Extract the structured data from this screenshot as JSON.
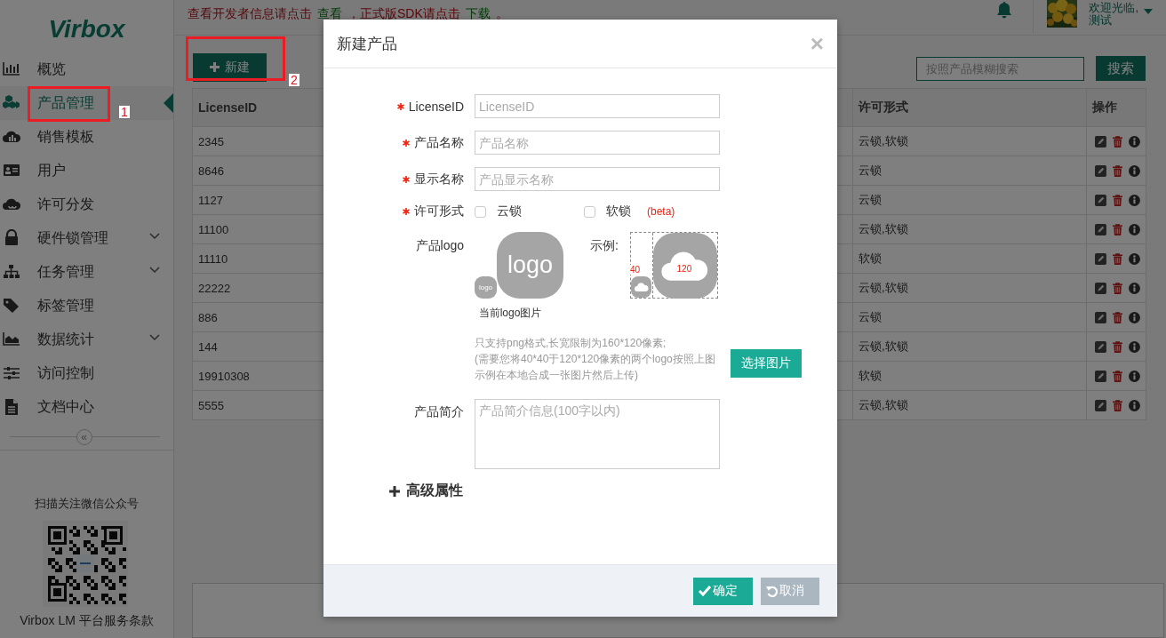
{
  "header": {
    "notice": [
      {
        "kind": "text",
        "text": "查看开发者信息请点击"
      },
      {
        "kind": "link",
        "text": "查看"
      },
      {
        "kind": "text",
        "text": "，正式版SDK请点击"
      },
      {
        "kind": "link",
        "text": "下载"
      },
      {
        "kind": "text",
        "text": "。"
      }
    ],
    "user": {
      "greeting": "欢迎光临,",
      "name": "测试"
    }
  },
  "sidebar": {
    "logo": "Virbox",
    "items": [
      {
        "label": "概览",
        "selected": false,
        "expandable": false
      },
      {
        "label": "产品管理",
        "selected": true,
        "expandable": false
      },
      {
        "label": "销售模板",
        "selected": false,
        "expandable": false
      },
      {
        "label": "用户",
        "selected": false,
        "expandable": false
      },
      {
        "label": "许可分发",
        "selected": false,
        "expandable": false
      },
      {
        "label": "硬件锁管理",
        "selected": false,
        "expandable": true
      },
      {
        "label": "任务管理",
        "selected": false,
        "expandable": true
      },
      {
        "label": "标签管理",
        "selected": false,
        "expandable": false
      },
      {
        "label": "数据统计",
        "selected": false,
        "expandable": true
      },
      {
        "label": "访问控制",
        "selected": false,
        "expandable": false
      },
      {
        "label": "文档中心",
        "selected": false,
        "expandable": false
      }
    ],
    "collapse": "«",
    "wechat_caption": "扫描关注微信公众号",
    "terms_link": "Virbox LM 平台服务条款"
  },
  "toolbar": {
    "new_button": "新建",
    "search_placeholder": "按照产品模糊搜索",
    "search_button": "搜索"
  },
  "table": {
    "columns": [
      "LicenseID",
      "许可形式",
      "操作"
    ],
    "rows": [
      {
        "license_id": "2345",
        "license_form": "云锁,软锁"
      },
      {
        "license_id": "8646",
        "license_form": "云锁"
      },
      {
        "license_id": "1127",
        "license_form": "云锁"
      },
      {
        "license_id": "11100",
        "license_form": "云锁,软锁"
      },
      {
        "license_id": "11110",
        "license_form": "软锁"
      },
      {
        "license_id": "22222",
        "license_form": "云锁,软锁"
      },
      {
        "license_id": "886",
        "license_form": "云锁"
      },
      {
        "license_id": "144",
        "license_form": "云锁,软锁"
      },
      {
        "license_id": "19910308",
        "license_form": "软锁"
      },
      {
        "license_id": "5555",
        "license_form": "云锁,软锁"
      }
    ]
  },
  "annotations": [
    {
      "label": "1"
    },
    {
      "label": "2"
    }
  ],
  "dialog": {
    "title": "新建产品",
    "close": "×",
    "fields": [
      {
        "label": "LicenseID",
        "required": true,
        "placeholder": "LicenseID"
      },
      {
        "label": "产品名称",
        "required": true,
        "placeholder": "产品名称"
      },
      {
        "label": "显示名称",
        "required": true,
        "placeholder": "产品显示名称"
      }
    ],
    "license_form": {
      "label": "许可形式",
      "required": true,
      "options": [
        {
          "label": "云锁",
          "checked": false
        },
        {
          "label": "软锁",
          "checked": false,
          "tag": "(beta)"
        }
      ]
    },
    "logo": {
      "label": "产品logo",
      "large": "logo",
      "small": "logo",
      "caption": "当前logo图片",
      "example_label": "示例:",
      "small_size": "40",
      "large_size": "120"
    },
    "hint": [
      "只支持png格式,长宽限制为160*120像素;",
      "(需要您将40*40于120*120像素的两个logo按照上图示例在本地合成一张图片然后上传)"
    ],
    "choose_button": "选择图片",
    "description": {
      "label": "产品简介",
      "placeholder": "产品简介信息(100字以内)"
    },
    "advanced": "高级属性",
    "confirm": "确定",
    "cancel": "取消"
  }
}
